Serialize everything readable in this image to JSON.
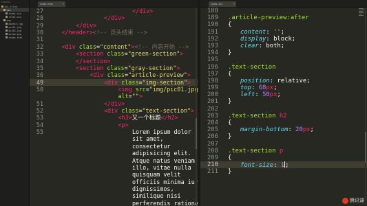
{
  "sidebar": {
    "header": "FOLDERS",
    "items": [
      {
        "label": "tpl_files",
        "kind": "folder",
        "selected": false
      },
      {
        "label": "css",
        "kind": "folder",
        "selected": true
      },
      {
        "label": "index.css",
        "kind": "file",
        "selected": false
      },
      {
        "label": "reset.css",
        "kind": "file",
        "selected": false
      },
      {
        "label": "img",
        "kind": "folder",
        "selected": false
      },
      {
        "label": "banner.jpg",
        "kind": "file",
        "selected": false
      },
      {
        "label": "pic01.jpg",
        "kind": "file",
        "selected": false
      },
      {
        "label": "pic02.jpg",
        "kind": "file",
        "selected": false
      },
      {
        "label": "weibo.png",
        "kind": "file",
        "selected": false
      },
      {
        "label": "index.html",
        "kind": "file",
        "selected": false
      }
    ]
  },
  "left_tab": {
    "label": "index.html",
    "close": "×"
  },
  "right_tab": {
    "label": "index.css",
    "close": "×"
  },
  "left_lines": [
    {
      "n": "27",
      "indent": 6,
      "toks": [
        [
          "t",
          "</div>"
        ]
      ]
    },
    {
      "n": "28",
      "indent": 4,
      "toks": [
        [
          "t",
          "</div>"
        ]
      ]
    },
    {
      "n": "29",
      "indent": 2,
      "toks": [
        [
          "t",
          "</div>"
        ]
      ]
    },
    {
      "n": "30",
      "indent": 1,
      "toks": [
        [
          "t",
          "</header>"
        ],
        [
          "c",
          "<!-- 页头结束 -->"
        ]
      ]
    },
    {
      "n": "31",
      "indent": 0,
      "toks": []
    },
    {
      "n": "32",
      "indent": 1,
      "toks": [
        [
          "t",
          "<div "
        ],
        [
          "a",
          "class"
        ],
        [
          "w",
          "="
        ],
        [
          "s",
          "\"content\""
        ],
        [
          "t",
          ">"
        ],
        [
          "c",
          "<!-- 内容开始 -->"
        ]
      ]
    },
    {
      "n": "33",
      "indent": 2,
      "toks": [
        [
          "t",
          "<section "
        ],
        [
          "a",
          "class"
        ],
        [
          "w",
          "="
        ],
        [
          "s",
          "\"green-section\""
        ],
        [
          "t",
          ">"
        ]
      ]
    },
    {
      "n": "34",
      "indent": 2,
      "toks": [
        [
          "t",
          "</section>"
        ]
      ]
    },
    {
      "n": "35",
      "indent": 2,
      "toks": [
        [
          "t",
          "<section "
        ],
        [
          "a",
          "class"
        ],
        [
          "w",
          "="
        ],
        [
          "s",
          "\"gray-section\""
        ],
        [
          "t",
          ">"
        ]
      ]
    },
    {
      "n": "36",
      "indent": 3,
      "toks": [
        [
          "t",
          "<div "
        ],
        [
          "a",
          "class"
        ],
        [
          "w",
          "="
        ],
        [
          "s",
          "\"article-preview\""
        ],
        [
          "t",
          ">"
        ]
      ]
    },
    {
      "n": "49",
      "indent": 4,
      "toks": [
        [
          "t",
          "<div "
        ],
        [
          "a",
          "class"
        ],
        [
          "w",
          "="
        ],
        [
          "s",
          "\"img-section\""
        ],
        [
          "t",
          ">"
        ]
      ]
    },
    {
      "n": "50",
      "indent": 5,
      "toks": [
        [
          "t",
          "<img "
        ],
        [
          "a",
          "src"
        ],
        [
          "w",
          "="
        ],
        [
          "s",
          "\"img/pic01.jpg\""
        ]
      ]
    },
    {
      "n": "",
      "indent": 5,
      "toks": [
        [
          "a",
          "alt"
        ],
        [
          "w",
          "="
        ],
        [
          "s",
          "\"\""
        ],
        [
          "t",
          ">"
        ]
      ]
    },
    {
      "n": "51",
      "indent": 4,
      "toks": [
        [
          "t",
          "</div>"
        ]
      ]
    },
    {
      "n": "52",
      "indent": 4,
      "toks": [
        [
          "t",
          "<div "
        ],
        [
          "a",
          "class"
        ],
        [
          "w",
          "="
        ],
        [
          "s",
          "\"text-section\""
        ],
        [
          "t",
          ">"
        ]
      ]
    },
    {
      "n": "53",
      "indent": 5,
      "toks": [
        [
          "t",
          "<h3>"
        ],
        [
          "w",
          "又一个标题"
        ],
        [
          "t",
          "</h2>"
        ]
      ]
    },
    {
      "n": "54",
      "indent": 5,
      "toks": [
        [
          "t",
          "<p>"
        ]
      ]
    },
    {
      "n": "55",
      "indent": 6,
      "toks": [
        [
          "w",
          "Lorem ipsum dolor"
        ]
      ]
    },
    {
      "n": "",
      "indent": 6,
      "toks": [
        [
          "w",
          "sit amet,"
        ]
      ]
    },
    {
      "n": "",
      "indent": 6,
      "toks": [
        [
          "w",
          "consectetur"
        ]
      ]
    },
    {
      "n": "",
      "indent": 6,
      "toks": [
        [
          "w",
          "adipisicing elit."
        ]
      ]
    },
    {
      "n": "",
      "indent": 6,
      "toks": [
        [
          "w",
          "Atque natus veniam"
        ]
      ]
    },
    {
      "n": "",
      "indent": 6,
      "toks": [
        [
          "w",
          "illo, vitae nulla"
        ]
      ]
    },
    {
      "n": "",
      "indent": 6,
      "toks": [
        [
          "w",
          "quisquam velit"
        ]
      ]
    },
    {
      "n": "",
      "indent": 6,
      "toks": [
        [
          "w",
          "officiis minima iure"
        ]
      ]
    },
    {
      "n": "",
      "indent": 6,
      "toks": [
        [
          "w",
          "dignissimos,"
        ]
      ]
    },
    {
      "n": "",
      "indent": 6,
      "toks": [
        [
          "w",
          "similique nisi"
        ]
      ]
    },
    {
      "n": "",
      "indent": 6,
      "toks": [
        [
          "w",
          "perferendis ratione"
        ]
      ]
    }
  ],
  "right_lines": [
    {
      "n": "188",
      "indent": 0,
      "toks": []
    },
    {
      "n": "189",
      "indent": 0,
      "toks": [
        [
          "a",
          ".article-preview:after"
        ]
      ]
    },
    {
      "n": "190",
      "indent": 0,
      "toks": [
        [
          "w",
          "{"
        ]
      ]
    },
    {
      "n": "191",
      "indent": 1,
      "toks": [
        [
          "p",
          "content"
        ],
        [
          "w",
          ": "
        ],
        [
          "s",
          "''"
        ],
        [
          "w",
          ";"
        ]
      ]
    },
    {
      "n": "192",
      "indent": 1,
      "toks": [
        [
          "p",
          "display"
        ],
        [
          "w",
          ": "
        ],
        [
          "w",
          "block;"
        ]
      ]
    },
    {
      "n": "193",
      "indent": 1,
      "toks": [
        [
          "p",
          "clear"
        ],
        [
          "w",
          ": "
        ],
        [
          "w",
          "both;"
        ]
      ]
    },
    {
      "n": "194",
      "indent": 0,
      "toks": [
        [
          "w",
          "}"
        ]
      ]
    },
    {
      "n": "195",
      "indent": 0,
      "toks": []
    },
    {
      "n": "196",
      "indent": 0,
      "toks": [
        [
          "a",
          ".text-section"
        ]
      ]
    },
    {
      "n": "197",
      "indent": 0,
      "toks": [
        [
          "w",
          "{"
        ]
      ]
    },
    {
      "n": "198",
      "indent": 1,
      "toks": [
        [
          "p",
          "position"
        ],
        [
          "w",
          ": "
        ],
        [
          "w",
          "relative;"
        ]
      ]
    },
    {
      "n": "199",
      "indent": 1,
      "toks": [
        [
          "p",
          "top"
        ],
        [
          "w",
          ": "
        ],
        [
          "n",
          "68"
        ],
        [
          "t",
          "px"
        ],
        [
          "w",
          ";"
        ]
      ]
    },
    {
      "n": "200",
      "indent": 1,
      "toks": [
        [
          "p",
          "left"
        ],
        [
          "w",
          ": "
        ],
        [
          "n",
          "50"
        ],
        [
          "t",
          "px"
        ],
        [
          "w",
          ";"
        ]
      ]
    },
    {
      "n": "201",
      "indent": 0,
      "toks": [
        [
          "w",
          "}"
        ]
      ]
    },
    {
      "n": "202",
      "indent": 0,
      "toks": []
    },
    {
      "n": "203",
      "indent": 0,
      "toks": [
        [
          "a",
          ".text-section "
        ],
        [
          "t",
          "h2"
        ]
      ]
    },
    {
      "n": "204",
      "indent": 0,
      "toks": [
        [
          "w",
          "{"
        ]
      ]
    },
    {
      "n": "205",
      "indent": 1,
      "toks": [
        [
          "p",
          "margin-bottom"
        ],
        [
          "w",
          ": "
        ],
        [
          "n",
          "20"
        ],
        [
          "t",
          "px"
        ],
        [
          "w",
          ";"
        ]
      ]
    },
    {
      "n": "206",
      "indent": 0,
      "toks": [
        [
          "w",
          "}"
        ]
      ]
    },
    {
      "n": "207",
      "indent": 0,
      "toks": []
    },
    {
      "n": "208",
      "indent": 0,
      "toks": [
        [
          "a",
          ".text-section "
        ],
        [
          "t",
          "p"
        ]
      ]
    },
    {
      "n": "209",
      "indent": 0,
      "toks": [
        [
          "w",
          "{"
        ]
      ]
    },
    {
      "n": "210",
      "indent": 1,
      "toks": [
        [
          "p",
          "font-size"
        ],
        [
          "w",
          ": "
        ],
        [
          "n",
          "1"
        ],
        [
          "w",
          ";"
        ]
      ]
    },
    {
      "n": "211",
      "indent": 0,
      "toks": [
        [
          "w",
          "}"
        ]
      ]
    }
  ],
  "left_highlight_line": "49",
  "right_highlight_line": "210",
  "logo_text": "腾讯课",
  "colors": {
    "background": "#272822",
    "tag": "#f92672",
    "attr": "#a6e22e",
    "string": "#e6db74",
    "comment": "#75715e",
    "property": "#66d9ef",
    "number": "#ae81ff",
    "plain": "#f8f8f2"
  }
}
